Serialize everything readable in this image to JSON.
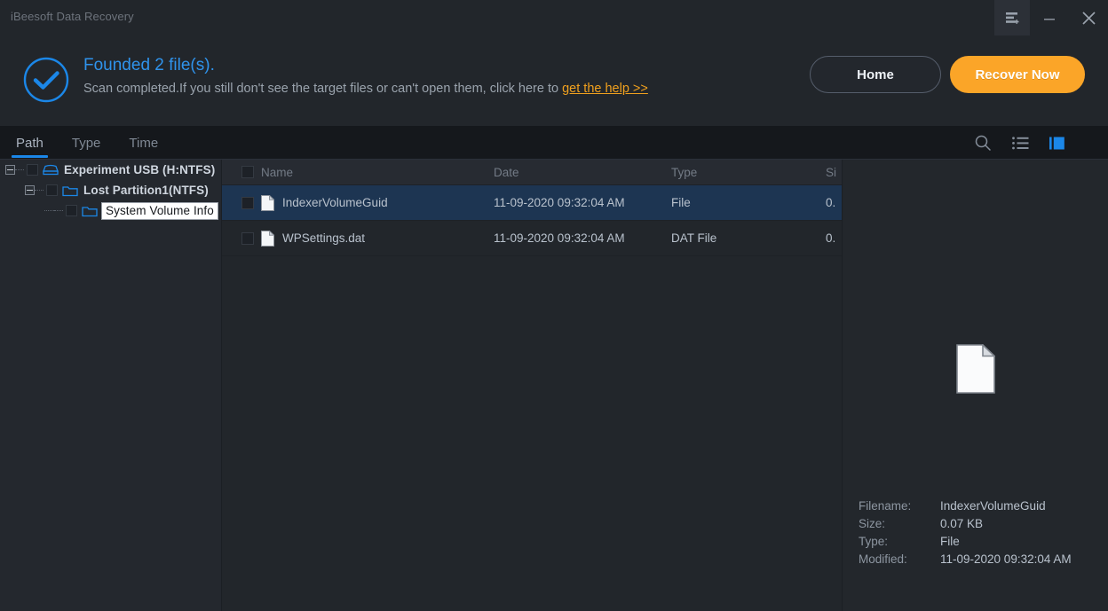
{
  "window": {
    "app_title": "iBeesoft Data Recovery",
    "controls": [
      {
        "name": "menu-icon",
        "label": "Menu"
      },
      {
        "name": "minimize-icon",
        "label": "Minimize"
      },
      {
        "name": "close-icon",
        "label": "Close"
      }
    ]
  },
  "header": {
    "status_icon": "check-circle-icon",
    "status_title": "Founded 2 file(s).",
    "status_sub_prefix": "Scan completed.If you still don't see the target files or can't open them, click here to ",
    "help_link": "get the help >>",
    "home_label": "Home",
    "recover_label": "Recover Now",
    "accent_blue": "#2f93ec",
    "accent_orange": "#fba528",
    "link_orange": "#f0a01e"
  },
  "tabbar": {
    "tabs": [
      {
        "label": "Path",
        "active": true
      },
      {
        "label": "Type",
        "active": false
      },
      {
        "label": "Time",
        "active": false
      }
    ],
    "tools": [
      {
        "name": "search-icon",
        "active": false
      },
      {
        "name": "list-view-icon",
        "active": false
      },
      {
        "name": "preview-pane-icon",
        "active": true
      }
    ],
    "active_underline_color": "#1b87e8"
  },
  "tree": {
    "items": [
      {
        "label": "Experiment USB (H:NTFS)",
        "icon": "drive-icon",
        "depth": 0,
        "expanded": true,
        "checked": false,
        "tooltip": false
      },
      {
        "label": "Lost Partition1(NTFS)",
        "icon": "folder-icon",
        "depth": 1,
        "expanded": true,
        "checked": false,
        "tooltip": false
      },
      {
        "label": "System Volume Info",
        "icon": "folder-icon",
        "depth": 2,
        "expanded": false,
        "checked": false,
        "tooltip": true
      }
    ]
  },
  "filelist": {
    "columns": [
      "Name",
      "Date",
      "Type",
      "Si"
    ],
    "rows": [
      {
        "name": "IndexerVolumeGuid",
        "date": "11-09-2020 09:32:04 AM",
        "type": "File",
        "size": "0.",
        "selected": true,
        "checked": false,
        "icon": "file-icon"
      },
      {
        "name": "WPSettings.dat",
        "date": "11-09-2020 09:32:04 AM",
        "type": "DAT File",
        "size": "0.",
        "selected": false,
        "checked": false,
        "icon": "file-icon"
      }
    ],
    "selection_color": "#1d3552"
  },
  "preview": {
    "icon": "file-icon",
    "meta": [
      {
        "label": "Filename:",
        "value": "IndexerVolumeGuid"
      },
      {
        "label": "Size:",
        "value": "0.07 KB"
      },
      {
        "label": "Type:",
        "value": "File"
      },
      {
        "label": "Modified:",
        "value": "11-09-2020 09:32:04 AM"
      }
    ]
  }
}
